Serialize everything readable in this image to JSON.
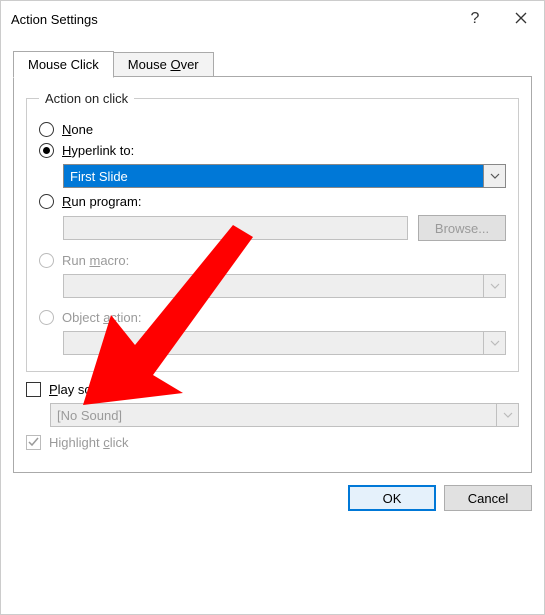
{
  "title": "Action Settings",
  "tabs": {
    "mouse_click": "Mouse Click",
    "mouse_over": "Mouse Over"
  },
  "fieldset_legend": "Action on click",
  "options": {
    "none": "None",
    "hyperlink": "Hyperlink to:",
    "hyperlink_value": "First Slide",
    "run_program": "Run program:",
    "run_program_value": "",
    "browse": "Browse...",
    "run_macro": "Run macro:",
    "run_macro_value": "",
    "object_action": "Object action:",
    "object_action_value": ""
  },
  "play_sound": {
    "label": "Play sound:",
    "value": "[No Sound]"
  },
  "highlight_click": "Highlight click",
  "buttons": {
    "ok": "OK",
    "cancel": "Cancel"
  }
}
